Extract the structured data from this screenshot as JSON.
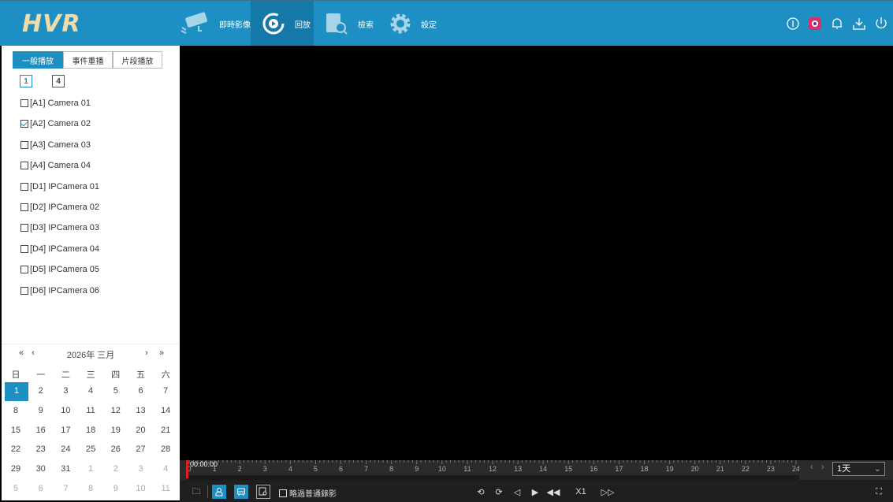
{
  "app": {
    "logo": "HVR"
  },
  "nav": [
    {
      "label": "即時影像",
      "icon": "camera-icon"
    },
    {
      "label": "回放",
      "icon": "playback-icon",
      "active": true
    },
    {
      "label": "檢索",
      "icon": "search-doc-icon"
    },
    {
      "label": "設定",
      "icon": "gear-icon"
    }
  ],
  "header_icons": [
    "info-icon",
    "camera-app-icon",
    "bell-icon",
    "download-icon",
    "power-icon"
  ],
  "tabs": [
    "一般播放",
    "事件重播",
    "片段播放"
  ],
  "layouts": [
    "1",
    "4"
  ],
  "cameras": [
    {
      "label": "[A1] Camera 01",
      "checked": false
    },
    {
      "label": "[A2] Camera 02",
      "checked": true
    },
    {
      "label": "[A3] Camera 03",
      "checked": false
    },
    {
      "label": "[A4] Camera 04",
      "checked": false
    },
    {
      "label": "[D1] IPCamera 01",
      "checked": false
    },
    {
      "label": "[D2] IPCamera 02",
      "checked": false
    },
    {
      "label": "[D3] IPCamera 03",
      "checked": false
    },
    {
      "label": "[D4] IPCamera 04",
      "checked": false
    },
    {
      "label": "[D5] IPCamera 05",
      "checked": false
    },
    {
      "label": "[D6] IPCamera 06",
      "checked": false
    }
  ],
  "calendar": {
    "title": "2026年 三月",
    "prev_year": "«",
    "prev_month": "‹",
    "next_month": "›",
    "next_year": "»",
    "weekdays": [
      "日",
      "一",
      "二",
      "三",
      "四",
      "五",
      "六"
    ],
    "days": [
      [
        "1",
        "2",
        "3",
        "4",
        "5",
        "6",
        "7"
      ],
      [
        "8",
        "9",
        "10",
        "11",
        "12",
        "13",
        "14"
      ],
      [
        "15",
        "16",
        "17",
        "18",
        "19",
        "20",
        "21"
      ],
      [
        "22",
        "23",
        "24",
        "25",
        "26",
        "27",
        "28"
      ],
      [
        "29",
        "30",
        "31",
        "1",
        "2",
        "3",
        "4"
      ],
      [
        "5",
        "6",
        "7",
        "8",
        "9",
        "10",
        "11"
      ]
    ],
    "selected": "1"
  },
  "timeline": {
    "current_time": "00:00:00",
    "hours": [
      "0",
      "1",
      "2",
      "3",
      "4",
      "5",
      "6",
      "7",
      "8",
      "9",
      "10",
      "11",
      "12",
      "13",
      "14",
      "15",
      "16",
      "17",
      "18",
      "19",
      "20",
      "21",
      "22",
      "23",
      "24"
    ],
    "range": "1天"
  },
  "controls": {
    "skip_label": "略過普通錄影",
    "skip_checked": false,
    "speed": "X1"
  }
}
